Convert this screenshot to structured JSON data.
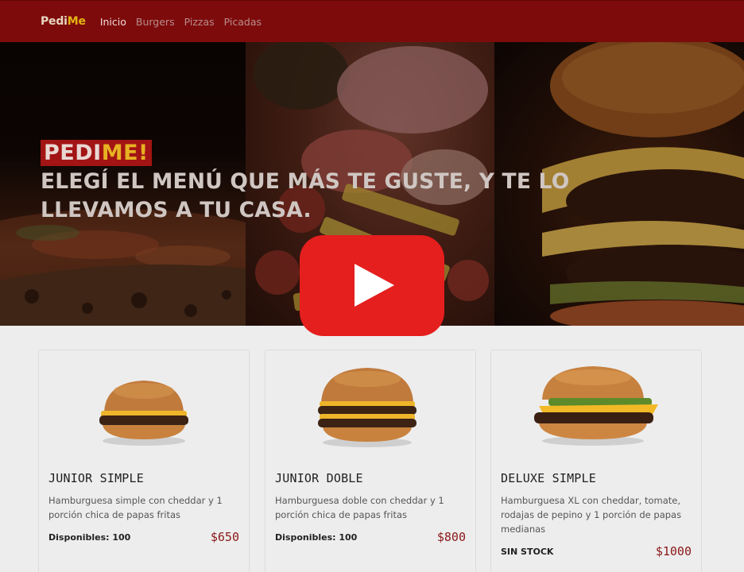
{
  "nav": {
    "brand_part1": "Pedi",
    "brand_part2": "Me",
    "links": [
      "Inicio",
      "Burgers",
      "Pizzas",
      "Picadas"
    ]
  },
  "hero": {
    "badge_part1": "PEDI",
    "badge_part2": "ME!",
    "tagline": "Elegí el menú que más te guste, y te lo llevamos a tu casa."
  },
  "video": {
    "icon": "youtube-play-icon"
  },
  "products": [
    {
      "name": "JUNIOR SIMPLE",
      "description": "Hamburguesa simple con cheddar y 1 porción chica de papas fritas",
      "stock": "Disponibles: 100",
      "price": "$650"
    },
    {
      "name": "JUNIOR DOBLE",
      "description": "Hamburguesa doble con cheddar y 1 porción chica de papas fritas",
      "stock": "Disponibles: 100",
      "price": "$800"
    },
    {
      "name": "DELUXE SIMPLE",
      "description": "Hamburguesa XL con cheddar, tomate, rodajas de pepino y 1 porción de papas medianas",
      "stock": "SIN STOCK",
      "price": "$1000"
    }
  ],
  "colors": {
    "navbar": "#7e0b0b",
    "accent_yellow": "#e2b415",
    "play_red": "#e51e1e",
    "price": "#8b1717"
  }
}
